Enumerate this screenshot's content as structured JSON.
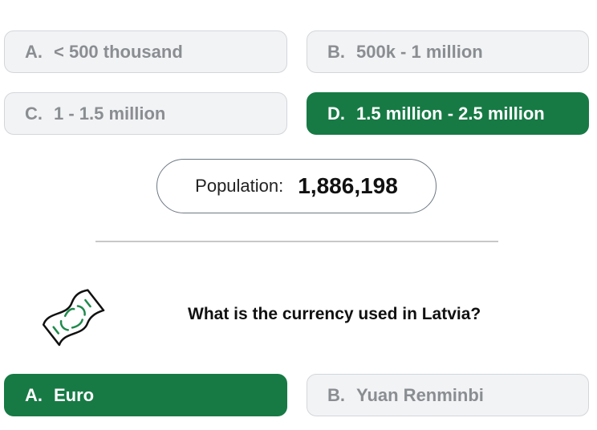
{
  "population_question": {
    "options": [
      {
        "letter": "A.",
        "text": "< 500 thousand",
        "state": "neutral"
      },
      {
        "letter": "B.",
        "text": "500k - 1 million",
        "state": "neutral"
      },
      {
        "letter": "C.",
        "text": "1 - 1.5 million",
        "state": "neutral"
      },
      {
        "letter": "D.",
        "text": "1.5 million - 2.5 million",
        "state": "correct"
      }
    ]
  },
  "population": {
    "label": "Population:",
    "value": "1,886,198"
  },
  "currency_question": {
    "icon": "money-banknote-icon",
    "text": "What is the currency used in Latvia?",
    "options": [
      {
        "letter": "A.",
        "text": "Euro",
        "state": "correct"
      },
      {
        "letter": "B.",
        "text": "Yuan Renminbi",
        "state": "neutral"
      }
    ]
  },
  "colors": {
    "correct": "#177a45",
    "neutral_bg": "#f2f3f5",
    "neutral_text": "#8a8d91",
    "neutral_border": "#d3d6da"
  }
}
